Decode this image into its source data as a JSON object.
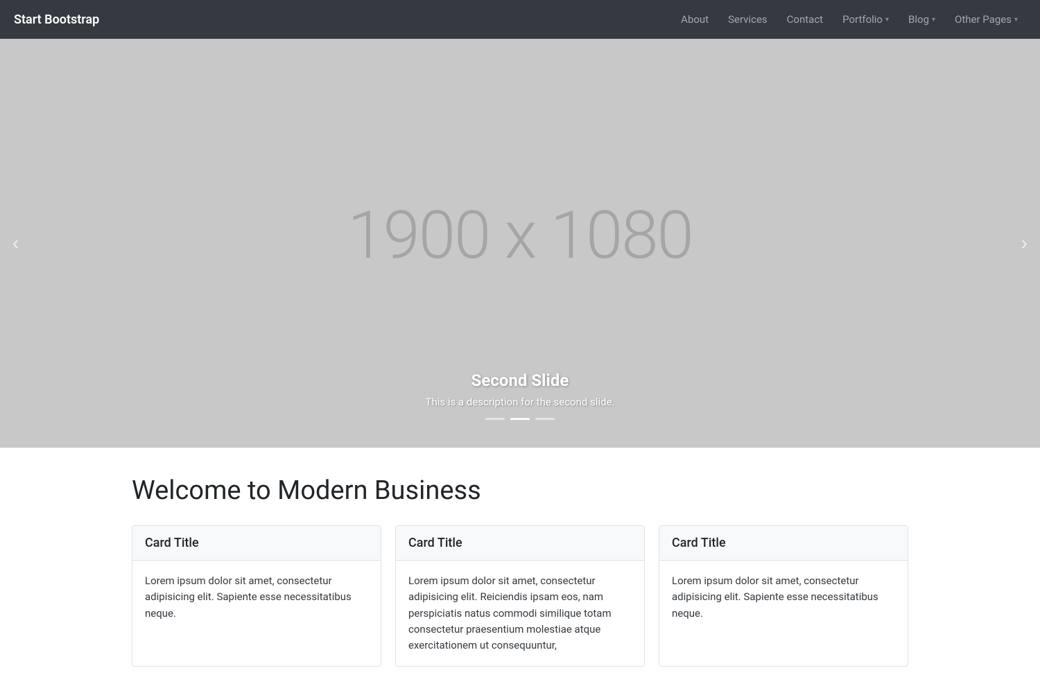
{
  "navbar": {
    "brand": "Start Bootstrap",
    "links": [
      {
        "label": "About",
        "dropdown": false
      },
      {
        "label": "Services",
        "dropdown": false
      },
      {
        "label": "Contact",
        "dropdown": false
      },
      {
        "label": "Portfolio",
        "dropdown": true
      },
      {
        "label": "Blog",
        "dropdown": true
      },
      {
        "label": "Other Pages",
        "dropdown": true
      }
    ]
  },
  "carousel": {
    "placeholder": "1900 x 1080",
    "prev_label": "‹",
    "next_label": "›",
    "slide_title": "Second Slide",
    "slide_description": "This is a description for the second slide.",
    "indicators": [
      {
        "active": false
      },
      {
        "active": true
      },
      {
        "active": false
      }
    ]
  },
  "section": {
    "title": "Welcome to Modern Business",
    "cards": [
      {
        "title": "Card Title",
        "body": "Lorem ipsum dolor sit amet, consectetur adipisicing elit. Sapiente esse necessitatibus neque."
      },
      {
        "title": "Card Title",
        "body": "Lorem ipsum dolor sit amet, consectetur adipisicing elit. Reiciendis ipsam eos, nam perspiciatis natus commodi similique totam consectetur praesentium molestiae atque exercitationem ut consequuntur,"
      },
      {
        "title": "Card Title",
        "body": "Lorem ipsum dolor sit amet, consectetur adipisicing elit. Sapiente esse necessitatibus neque."
      }
    ]
  }
}
